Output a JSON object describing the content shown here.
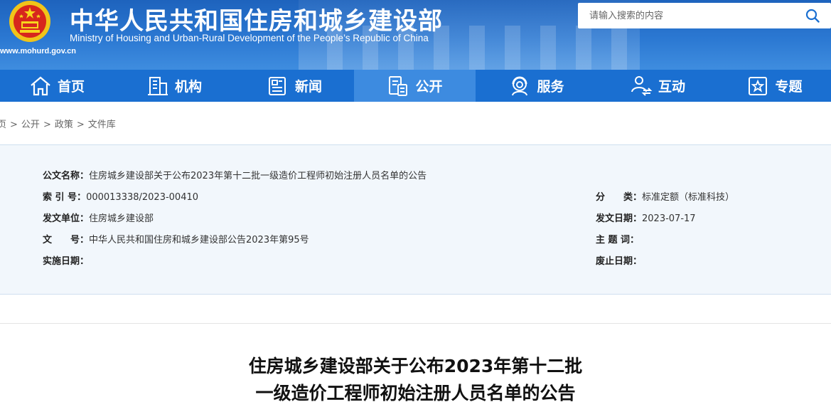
{
  "header": {
    "site_title_cn": "中华人民共和国住房和城乡建设部",
    "site_title_en": "Ministry of Housing and Urban-Rural Development of the People’s Republic of China",
    "site_url": "www.mohurd.gov.cn",
    "search_placeholder": "请输入搜索的内容"
  },
  "nav": {
    "items": [
      {
        "label": "首页",
        "icon": "home-icon"
      },
      {
        "label": "机构",
        "icon": "building-icon"
      },
      {
        "label": "新闻",
        "icon": "news-icon"
      },
      {
        "label": "公开",
        "icon": "public-docs-icon",
        "active": true
      },
      {
        "label": "服务",
        "icon": "service-icon"
      },
      {
        "label": "互动",
        "icon": "interaction-icon"
      },
      {
        "label": "专题",
        "icon": "topic-icon"
      }
    ]
  },
  "breadcrumb": [
    "页",
    "公开",
    "政策",
    "文件库"
  ],
  "meta": {
    "doc_name_label": "公文名称：",
    "doc_name_value": "住房城乡建设部关于公布2023年第十二批一级造价工程师初始注册人员名单的公告",
    "index_label": "索 引 号：",
    "index_value": "000013338/2023-00410",
    "category_label": "分　　类：",
    "category_value": "标准定额（标准科技）",
    "issuer_label": "发文单位：",
    "issuer_value": "住房城乡建设部",
    "issue_date_label": "发文日期：",
    "issue_date_value": "2023-07-17",
    "doc_no_label": "文　　号：",
    "doc_no_value": "中华人民共和国住房和城乡建设部公告2023年第95号",
    "keywords_label": "主 题 词：",
    "keywords_value": "",
    "effective_label": "实施日期：",
    "effective_value": "",
    "expiry_label": "废止日期：",
    "expiry_value": ""
  },
  "article": {
    "title_line1": "住房城乡建设部关于公布2023年第十二批",
    "title_line2": "一级造价工程师初始注册人员名单的公告"
  },
  "colors": {
    "nav_bg": "#1a6fd1",
    "nav_active_bg": "#3d8be0",
    "meta_bg": "#f2f7fc"
  }
}
